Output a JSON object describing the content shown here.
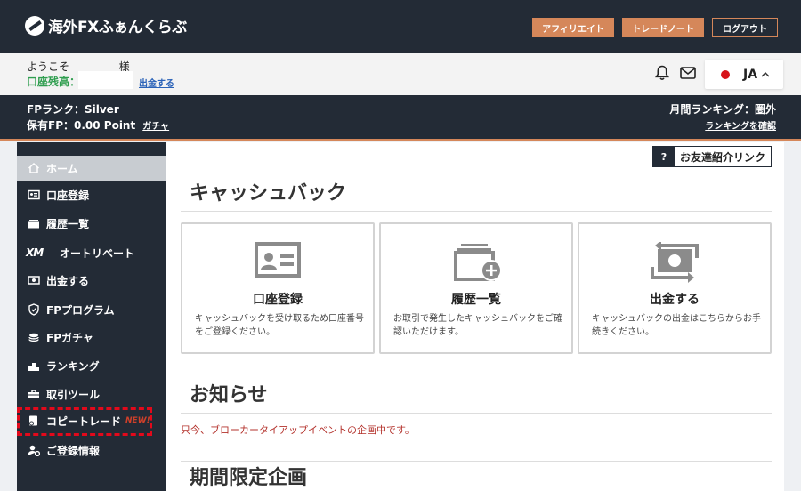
{
  "header": {
    "logo_text": "海外FXふぁんくらぶ",
    "buttons": [
      "アフィリエイト",
      "トレードノート",
      "ログアウト"
    ]
  },
  "welcome": {
    "greeting": "ようこそ",
    "honorific": "様",
    "balance_label": "口座残高：",
    "withdraw_link": "出金する",
    "language": "JA"
  },
  "rank": {
    "fp_rank": "FPランク：Silver",
    "fp_held": "保有FP：0.00 Point",
    "gacha_link": "ガチャ",
    "monthly_ranking": "月間ランキング：圏外",
    "ranking_link": "ランキングを確認"
  },
  "sidebar": {
    "items": [
      {
        "label": "ホーム",
        "icon": "home-icon"
      },
      {
        "label": "口座登録",
        "icon": "id-card-icon"
      },
      {
        "label": "履歴一覧",
        "icon": "history-icon"
      },
      {
        "label": "オートリベート",
        "icon": "xm-logo-icon",
        "icon_text": "XM"
      },
      {
        "label": "出金する",
        "icon": "cash-icon"
      },
      {
        "label": "FPプログラム",
        "icon": "shield-icon"
      },
      {
        "label": "FPガチャ",
        "icon": "coins-icon"
      },
      {
        "label": "ランキング",
        "icon": "podium-icon"
      },
      {
        "label": "取引ツール",
        "icon": "toolbox-icon"
      },
      {
        "label": "コピートレード",
        "icon": "copy-trade-icon",
        "badge": "NEW!"
      },
      {
        "label": "ご登録情報",
        "icon": "user-settings-icon"
      }
    ]
  },
  "main": {
    "referral_q": "?",
    "referral_label": "お友達紹介リンク",
    "cashback_title": "キャッシュバック",
    "cards": [
      {
        "title": "口座登録",
        "desc": "キャッシュバックを受け取るため口座番号をご登録ください。",
        "icon": "id-card-icon"
      },
      {
        "title": "履歴一覧",
        "desc": "お取引で発生したキャッシュバックをご確認いただけます。",
        "icon": "history-add-icon"
      },
      {
        "title": "出金する",
        "desc": "キャッシュバックの出金はこちらからお手続きください。",
        "icon": "cash-exchange-icon"
      }
    ],
    "news_title": "お知らせ",
    "news_item": "只今、ブローカータイアップイベントの企画中です。",
    "limited_title": "期間限定企画"
  },
  "colors": {
    "header_bg": "#232b36",
    "accent": "#d5875a",
    "balance_green": "#2f9e4f",
    "notice_red": "#b3312b",
    "highlight_red": "#e3091b"
  }
}
